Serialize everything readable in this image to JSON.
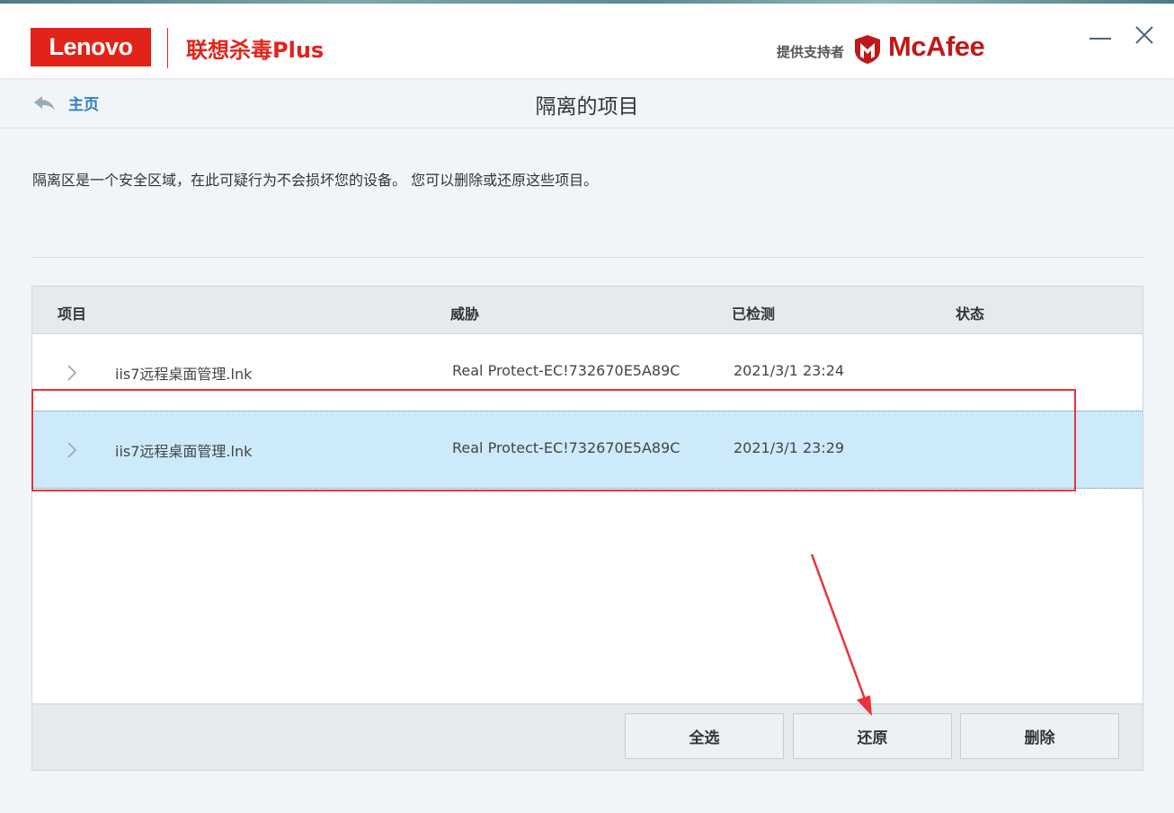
{
  "header": {
    "lenovo_logo": "Lenovo",
    "product_name": "联想杀毒Plus",
    "powered_by": "提供支持者",
    "mcafee_logo": "McAfee",
    "accent_color": "#e2231a"
  },
  "window_controls": {
    "minimize_icon": "minimize-icon",
    "close_icon": "close-icon"
  },
  "nav": {
    "back_label": "主页",
    "page_title": "隔离的项目"
  },
  "description": "隔离区是一个安全区域，在此可疑行为不会损坏您的设备。 您可以删除或还原这些项目。",
  "table": {
    "columns": [
      "项目",
      "威胁",
      "已检测",
      "状态"
    ],
    "rows": [
      {
        "item": "iis7远程桌面管理.lnk",
        "threat": "Real Protect-EC!732670E5A89C",
        "detected": "2021/3/1 23:24",
        "status": "",
        "selected": false
      },
      {
        "item": "iis7远程桌面管理.lnk",
        "threat": "Real Protect-EC!732670E5A89C",
        "detected": "2021/3/1 23:29",
        "status": "",
        "selected": true
      }
    ],
    "selected_row_color": "#cdeafb"
  },
  "buttons": {
    "select_all": "全选",
    "restore": "还原",
    "delete": "删除"
  },
  "annotation": {
    "highlight_color": "#e8333b"
  }
}
